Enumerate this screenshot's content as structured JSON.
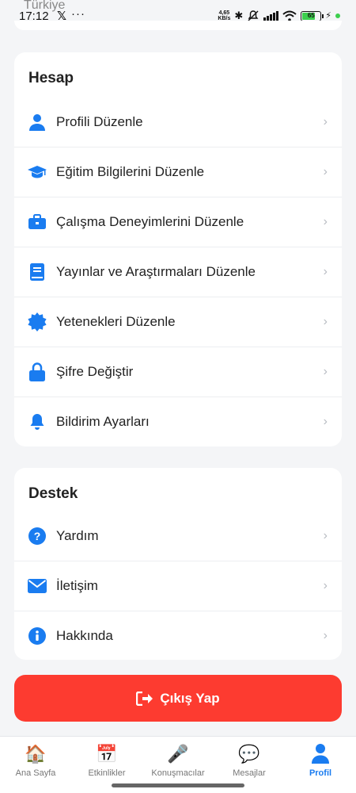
{
  "status_bar": {
    "carrier": "Türkiye",
    "time": "17:12",
    "speed_top": "4,65",
    "speed_unit": "KB/s",
    "battery": "65"
  },
  "account_section": {
    "title": "Hesap",
    "items": [
      {
        "label": "Profili Düzenle",
        "icon": "user-icon"
      },
      {
        "label": "Eğitim Bilgilerini Düzenle",
        "icon": "graduation-cap-icon"
      },
      {
        "label": "Çalışma Deneyimlerini Düzenle",
        "icon": "briefcase-icon"
      },
      {
        "label": "Yayınlar ve Araştırmaları Düzenle",
        "icon": "book-icon"
      },
      {
        "label": "Yetenekleri Düzenle",
        "icon": "badge-icon"
      },
      {
        "label": "Şifre Değiştir",
        "icon": "lock-icon"
      },
      {
        "label": "Bildirim Ayarları",
        "icon": "bell-icon"
      }
    ]
  },
  "support_section": {
    "title": "Destek",
    "items": [
      {
        "label": "Yardım",
        "icon": "question-icon"
      },
      {
        "label": "İletişim",
        "icon": "envelope-icon"
      },
      {
        "label": "Hakkında",
        "icon": "info-icon"
      }
    ]
  },
  "chevron": "›",
  "logout_label": "Çıkış Yap",
  "bottom_nav": {
    "tabs": [
      {
        "label": "Ana Sayfa",
        "icon": "home-icon",
        "glyph": "🏠"
      },
      {
        "label": "Etkinlikler",
        "icon": "calendar-icon",
        "glyph": "📅"
      },
      {
        "label": "Konuşmacılar",
        "icon": "microphone-icon",
        "glyph": "🎤"
      },
      {
        "label": "Mesajlar",
        "icon": "chat-bubble-icon",
        "glyph": "💬"
      },
      {
        "label": "Profil",
        "icon": "profile-icon",
        "glyph": "👤"
      }
    ],
    "active": "Profil"
  },
  "colors": {
    "accent": "#1a7cf0",
    "danger": "#fd3b30",
    "background": "#f4f5f7"
  }
}
